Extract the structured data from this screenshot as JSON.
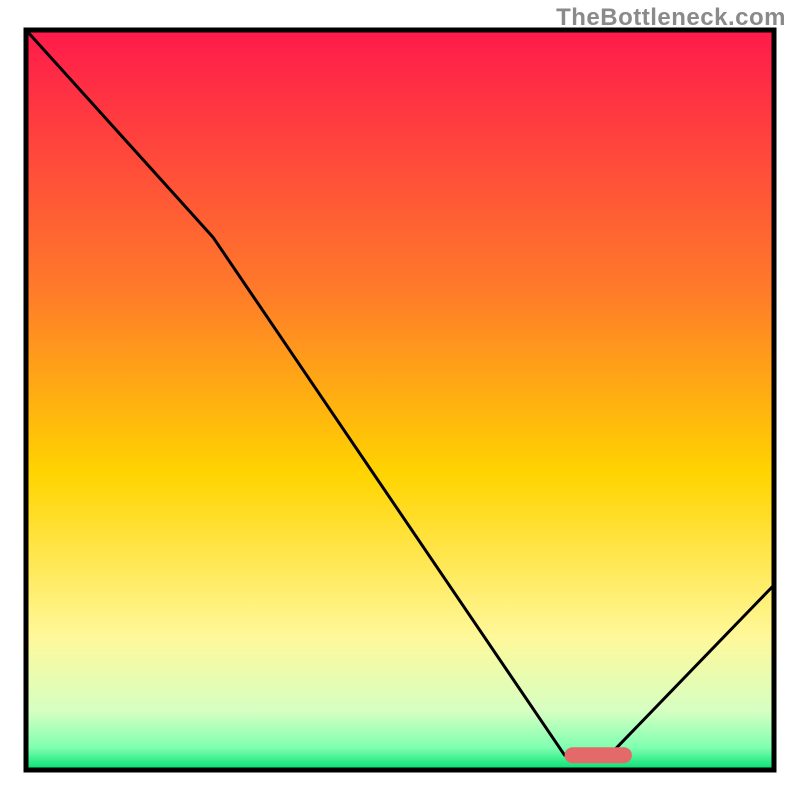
{
  "attribution": "TheBottleneck.com",
  "chart_data": {
    "type": "line",
    "title": "",
    "xlabel": "",
    "ylabel": "",
    "xlim": [
      0,
      100
    ],
    "ylim": [
      0,
      100
    ],
    "curve": [
      {
        "x": 0,
        "y": 100
      },
      {
        "x": 25,
        "y": 72
      },
      {
        "x": 72,
        "y": 2
      },
      {
        "x": 78,
        "y": 2
      },
      {
        "x": 100,
        "y": 25
      }
    ],
    "marker": {
      "x_start": 72,
      "x_end": 81,
      "y": 2
    },
    "background_gradient_stops": [
      {
        "offset": 0.0,
        "color": "#ff1a4b"
      },
      {
        "offset": 0.35,
        "color": "#ff7a2a"
      },
      {
        "offset": 0.6,
        "color": "#ffd400"
      },
      {
        "offset": 0.82,
        "color": "#fff89a"
      },
      {
        "offset": 0.92,
        "color": "#d6ffc2"
      },
      {
        "offset": 0.97,
        "color": "#7fffb0"
      },
      {
        "offset": 1.0,
        "color": "#00e070"
      }
    ],
    "marker_color": "#e46a6a",
    "curve_color": "#000000",
    "frame_color": "#000000"
  }
}
